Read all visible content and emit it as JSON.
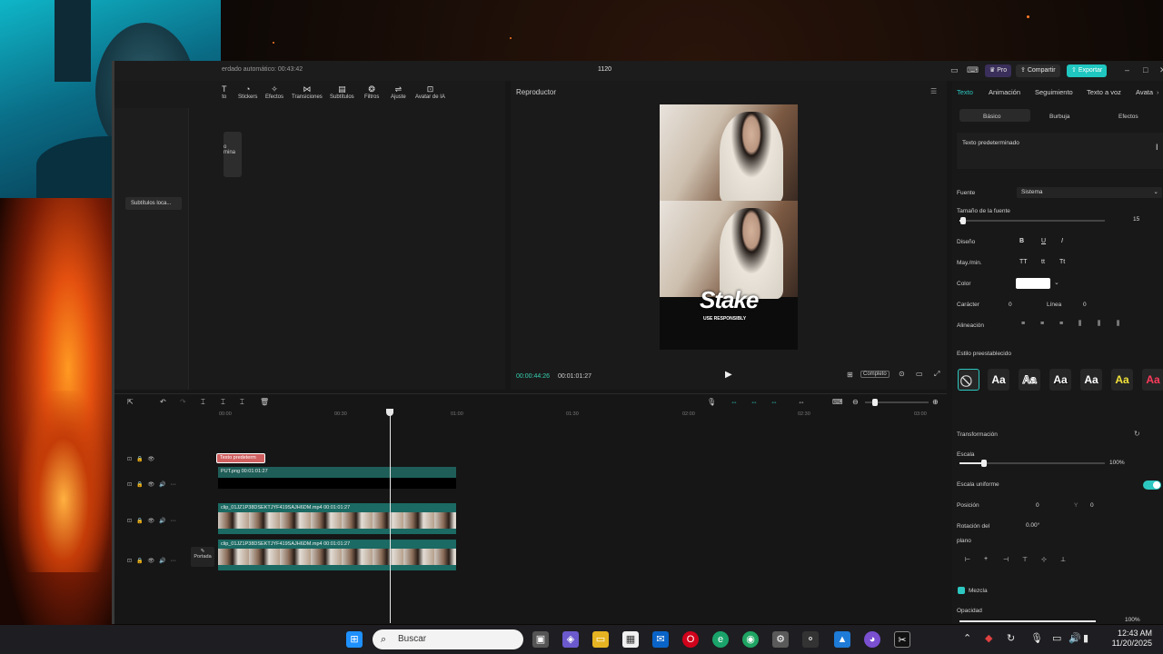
{
  "window": {
    "autosave": "erdado automático: 00:43:42",
    "project": "1120",
    "pro_label": "Pro",
    "share_label": "Compartir",
    "export_label": "Exportar",
    "export_color": "#1fc7c0"
  },
  "media_toolbar": {
    "items": [
      {
        "label": "to",
        "icon": "text-icon"
      },
      {
        "label": "Stickers",
        "icon": "sticker-icon"
      },
      {
        "label": "Efectos",
        "icon": "effects-icon"
      },
      {
        "label": "Transiciones",
        "icon": "transitions-icon"
      },
      {
        "label": "Subtítulos",
        "icon": "subtitles-icon"
      },
      {
        "label": "Filtros",
        "icon": "filters-icon"
      },
      {
        "label": "Ajuste",
        "icon": "adjust-icon"
      },
      {
        "label": "Avatar de IA",
        "icon": "ai-avatar-icon"
      }
    ],
    "card_label": "o\nmina",
    "local_subtitles": "Subtítulos loca..."
  },
  "player": {
    "title": "Reproductor",
    "current_time": "00:00:44:26",
    "total_time": "00:01:01:27",
    "ratio_label": "Completo",
    "overlay_brand": "Stake",
    "overlay_sub": "USE RESPONSIBLY"
  },
  "properties": {
    "tabs": [
      "Texto",
      "Animación",
      "Seguimiento",
      "Texto a voz",
      "Avata"
    ],
    "subtabs": [
      "Básico",
      "Burbuja",
      "Efectos"
    ],
    "text_value": "Texto predeterminado",
    "font_label": "Fuente",
    "font_value": "Sistema",
    "font_size_label": "Tamaño de la fuente",
    "font_size_value": "15",
    "design_label": "Diseño",
    "case_label": "May./min.",
    "color_label": "Color",
    "char_label": "Carácter",
    "char_value": "0",
    "line_label": "Línea",
    "line_value": "0",
    "align_label": "Alineación",
    "preset_label": "Estilo preestablecido",
    "preset_text": "Aa",
    "transform_label": "Transformación",
    "scale_label": "Escala",
    "scale_value": "100%",
    "uniform_label": "Escala uniforme",
    "position_label": "Posición",
    "pos_x": "0",
    "pos_y_label": "Y",
    "pos_y": "0",
    "rotation_label": "Rotación del",
    "rotation_label2": "plano",
    "rotation_value": "0.00°",
    "blend_label": "Mezcla",
    "opacity_label": "Opacidad",
    "opacity_value": "100%"
  },
  "timeline": {
    "ruler": [
      "00:00",
      "00:30",
      "01:00",
      "01:30",
      "02:00",
      "02:30",
      "03:00"
    ],
    "text_clip": "Texto predeterm",
    "image_clip": "PUT.png   00:01:01:27",
    "video_clip_1": "clip_01JZ1P38DSEKTJYF419SAJH6DM.mp4   00:01:01:27",
    "video_clip_2": "clip_01JZ1P38DSEKTJYF419SAJH6DM.mp4   00:01:01:27",
    "cover_label": "Portada"
  },
  "taskbar": {
    "search_placeholder": "Buscar",
    "time": "12:43 AM",
    "date": "11/20/2025"
  }
}
